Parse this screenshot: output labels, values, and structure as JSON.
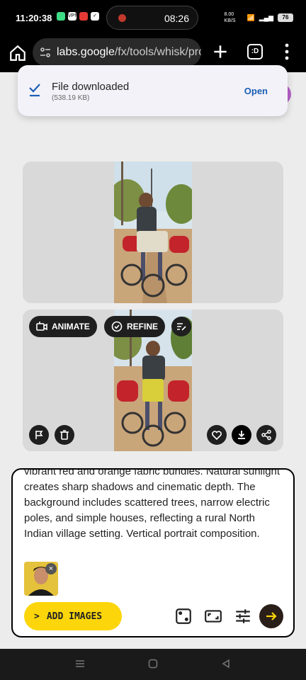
{
  "status": {
    "time": "11:20:38",
    "pill_time": "08:26",
    "net_speed": "8.00 KB/S",
    "battery": "76"
  },
  "browser": {
    "url_prefix": "labs.google",
    "url_rest": "/fx/tools/whisk/pro",
    "tab_label": ":D"
  },
  "toast": {
    "title": "File downloaded",
    "size": "(538.19 KB)",
    "action": "Open"
  },
  "card2": {
    "animate": "ANIMATE",
    "refine": "REFINE"
  },
  "prompt": {
    "text": "vibrant red and orange fabric bundles. Natural sunlight creates sharp shadows and cinematic depth. The background includes scattered trees, narrow electric poles, and simple houses, reflecting a rural North Indian village setting. Vertical portrait composition.",
    "add_images": "ADD IMAGES"
  },
  "colors": {
    "accent_yellow": "#fcd60a",
    "chip_dark": "#1f1f1f",
    "link_blue": "#1a5fb4"
  }
}
